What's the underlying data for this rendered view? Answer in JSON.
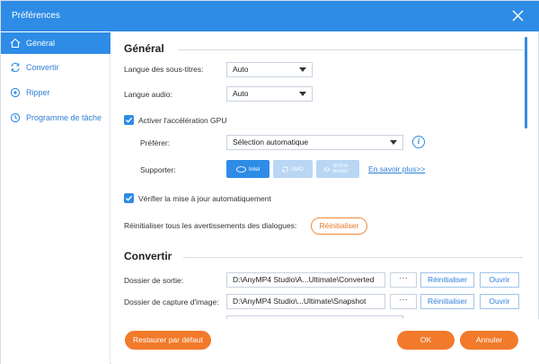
{
  "window": {
    "title": "Préférences"
  },
  "sidebar": {
    "items": [
      {
        "label": "Général",
        "icon": "home-icon",
        "active": true
      },
      {
        "label": "Convertir",
        "icon": "refresh-icon",
        "active": false
      },
      {
        "label": "Ripper",
        "icon": "disc-icon",
        "active": false
      },
      {
        "label": "Programme de tâche",
        "icon": "clock-icon",
        "active": false
      }
    ]
  },
  "general": {
    "title": "Général",
    "subtitle_language": {
      "label": "Langue des sous-titres:",
      "value": "Auto"
    },
    "audio_language": {
      "label": "Langue audio:",
      "value": "Auto"
    },
    "gpu": {
      "checkbox_label": "Activer l'accélération GPU",
      "checked": true,
      "prefer_label": "Préférer:",
      "prefer_value": "Sélection automatique",
      "support_label": "Supporter:",
      "vendors": [
        "Intel",
        "AMD",
        "NVIDIA NVENC"
      ],
      "learn_more": "En savoir plus>>"
    },
    "auto_update": {
      "label": "Vérifier la mise à jour automatiquement",
      "checked": true
    },
    "reset_warnings": {
      "label": "Réinitialiser tous les avertissements des dialogues:",
      "button": "Réinitialiser"
    }
  },
  "convert": {
    "title": "Convertir",
    "output_folder": {
      "label": "Dossier de sortie:",
      "path": "D:\\AnyMP4 Studio\\A...Ultimate\\Converted",
      "browse": "···",
      "reset": "Réinitialiser",
      "open": "Ouvrir"
    },
    "snapshot_folder": {
      "label": "Dossier de capture d'image:",
      "path": "D:\\AnyMP4 Studio\\...Ultimate\\Snapshot",
      "browse": "···",
      "reset": "Réinitialiser",
      "open": "Ouvrir"
    }
  },
  "footer": {
    "restore": "Restaurer par défaut",
    "ok": "OK",
    "cancel": "Annuler"
  },
  "colors": {
    "accent": "#2e8ce6",
    "orange": "#f27a2a"
  }
}
